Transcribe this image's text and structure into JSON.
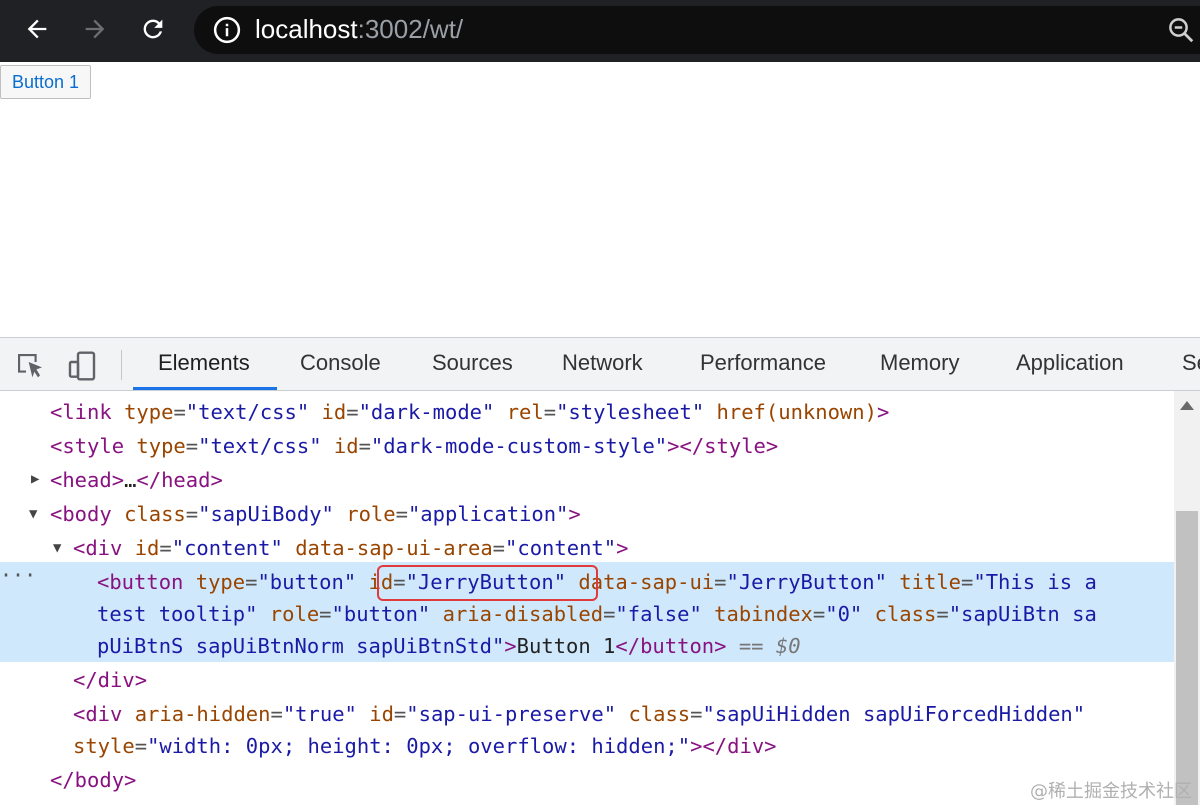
{
  "browser": {
    "url_host": "localhost",
    "url_rest": ":3002/wt/"
  },
  "page": {
    "button_label": "Button 1"
  },
  "devtools": {
    "tabs": [
      "Elements",
      "Console",
      "Sources",
      "Network",
      "Performance",
      "Memory",
      "Application",
      "Se"
    ],
    "active_tab": "Elements"
  },
  "dom_lines": {
    "l1": {
      "tag_open": "<link",
      "a1": "type",
      "v1": "\"text/css\"",
      "a2": "id",
      "v2": "\"dark-mode\"",
      "a3": "rel",
      "v3": "\"stylesheet\"",
      "a4": "href(unknown)",
      "tag_close": ">"
    },
    "l2": {
      "tag_open": "<style",
      "a1": "type",
      "v1": "\"text/css\"",
      "a2": "id",
      "v2": "\"dark-mode-custom-style\"",
      "tag_close": "></style>"
    },
    "l3": {
      "tag_open": "<head>",
      "ell": "…",
      "tag_close": "</head>"
    },
    "l4": {
      "tag_open": "<body",
      "a1": "class",
      "v1": "\"sapUiBody\"",
      "a2": "role",
      "v2": "\"application\"",
      "tag_close": ">"
    },
    "l5": {
      "tag_open": "<div",
      "a1": "id",
      "v1": "\"content\"",
      "a2": "data-sap-ui-area",
      "v2": "\"content\"",
      "tag_close": ">"
    },
    "l6": {
      "tag_open": "<button",
      "a1": "type",
      "v1": "\"button\"",
      "a2": "id",
      "v2": "\"JerryButton\"",
      "a3": "data-sap-ui",
      "v3": "\"JerryButton\"",
      "a4": "title",
      "v4a": "\"This is a"
    },
    "l7": {
      "v4b": "test tooltip\"",
      "a5": "role",
      "v5": "\"button\"",
      "a6": "aria-disabled",
      "v6": "\"false\"",
      "a7": "tabindex",
      "v7": "\"0\"",
      "a8": "class",
      "v8a": "\"sapUiBtn sa"
    },
    "l8": {
      "v8b": "pUiBtnS sapUiBtnNorm sapUiBtnStd\"",
      "tag_close": ">",
      "text": "Button 1",
      "end_tag": "</button>",
      "eq": " == ",
      "dollar": "$0"
    },
    "l9": {
      "tag": "</div>"
    },
    "l10": {
      "tag_open": "<div",
      "a1": "aria-hidden",
      "v1": "\"true\"",
      "a2": "id",
      "v2": "\"sap-ui-preserve\"",
      "a3": "class",
      "v3": "\"sapUiHidden sapUiForcedHidden\""
    },
    "l11": {
      "a4": "style",
      "v4": "\"width: 0px; height: 0px; overflow: hidden;\"",
      "tag_close": "></div>"
    },
    "l12": {
      "tag": "</body>"
    }
  },
  "ellipsis": "···",
  "watermark": "@稀土掘金技术社区",
  "colors": {
    "tag": "#881280",
    "attr": "#994500",
    "value": "#1a1aa6",
    "selection": "#cfe8fc",
    "highlight": "#e03a3a",
    "tab_accent": "#1a73e8"
  }
}
